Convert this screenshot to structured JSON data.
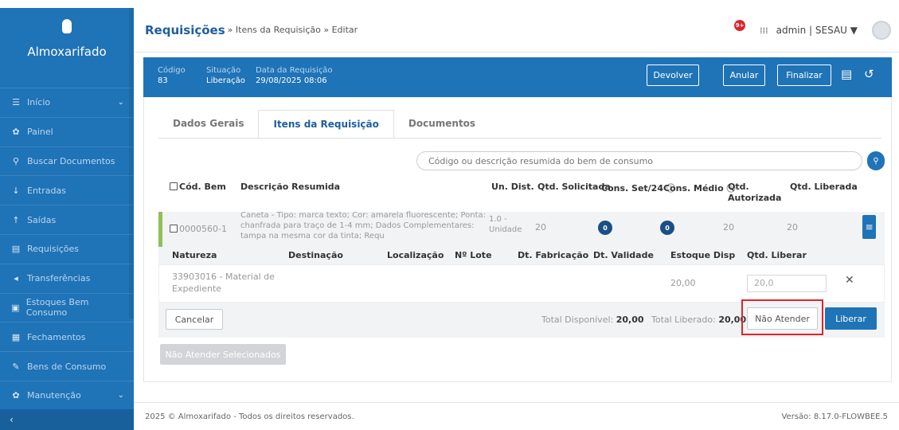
{
  "sidebar": {
    "brand": "Almoxarifado",
    "items": [
      {
        "label": "Início",
        "icon": "☰",
        "chevron": true
      },
      {
        "label": "Painel",
        "icon": "✿",
        "chevron": false
      },
      {
        "label": "Buscar Documentos",
        "icon": "⚲",
        "chevron": false
      },
      {
        "label": "Entradas",
        "icon": "↓",
        "chevron": false
      },
      {
        "label": "Saídas",
        "icon": "↑",
        "chevron": false
      },
      {
        "label": "Requisições",
        "icon": "▤",
        "chevron": false
      },
      {
        "label": "Transferências",
        "icon": "◂",
        "chevron": false
      },
      {
        "label": "Estoques Bem Consumo",
        "icon": "▣",
        "chevron": false
      },
      {
        "label": "Fechamentos",
        "icon": "▦",
        "chevron": false
      },
      {
        "label": "Bens de Consumo",
        "icon": "✎",
        "chevron": false
      },
      {
        "label": "Manutenção",
        "icon": "✿",
        "chevron": true
      }
    ],
    "collapse_icon": "‹"
  },
  "header": {
    "title": "Requisições",
    "breadcrumb_rest": "» Itens da Requisição » Editar",
    "notif_count": "9+",
    "user": "admin | SESAU ▼"
  },
  "info": {
    "codigo_label": "Código",
    "codigo_value": "83",
    "situacao_label": "Situação",
    "situacao_value": "Liberação",
    "data_label": "Data da Requisição",
    "data_value": "29/08/2025 08:06",
    "btn_devolver": "Devolver",
    "btn_anular": "Anular",
    "btn_finalizar": "Finalizar"
  },
  "tabs": [
    "Dados Gerais",
    "Itens da Requisição",
    "Documentos"
  ],
  "search": {
    "placeholder": "Código ou descrição resumida do bem de consumo"
  },
  "table": {
    "headers": {
      "cod": "Cód. Bem",
      "desc": "Descrição Resumida",
      "un": "Un. Dist.",
      "qsol": "Qtd. Solicitada",
      "cons": "Cons. Set/24",
      "cmed": "Cons. Médio",
      "qaut1": "Qtd.",
      "qaut2": "Autorizada",
      "qlib": "Qtd. Liberada"
    },
    "row": {
      "cod": "0000560-1",
      "desc": "Caneta - Tipo: marca texto; Cor: amarela fluorescente; Ponta: chanfrada para traço de 1-4 mm; Dados Complementares: tampa na mesma cor da tinta; Requ",
      "un1": "1.0 -",
      "un2": "Unidade",
      "qsol": "20",
      "cons": "0",
      "cmed": "0",
      "qaut": "20",
      "qlib": "20"
    },
    "sub_headers": {
      "natureza": "Natureza",
      "destinacao": "Destinação",
      "localizacao": "Localização",
      "lote": "Nº Lote",
      "fabricacao": "Dt. Fabricação",
      "validade": "Dt. Validade",
      "estoque": "Estoque Disp",
      "liberar": "Qtd. Liberar"
    },
    "sub_row": {
      "natureza1": "33903016 - Material de",
      "natureza2": "Expediente",
      "estoque": "20,00",
      "liberar_placeholder": "20,0"
    }
  },
  "actions": {
    "cancelar": "Cancelar",
    "total_disp_label": "Total Disponível:",
    "total_disp_value": "20,00",
    "total_lib_label": "Total Liberado:",
    "total_lib_value": "20,00",
    "nao_atender": "Não Atender",
    "liberar": "Liberar",
    "nao_atender_sel": "Não Atender Selecionados"
  },
  "footer": {
    "copyright": "2025 © Almoxarifado - Todos os direitos reservados.",
    "version": "Versão: 8.17.0-FLOWBEE.5"
  },
  "colors": {
    "primary": "#1f73b7",
    "highlight": "#e0232a",
    "stripe": "#8fbf5a"
  }
}
